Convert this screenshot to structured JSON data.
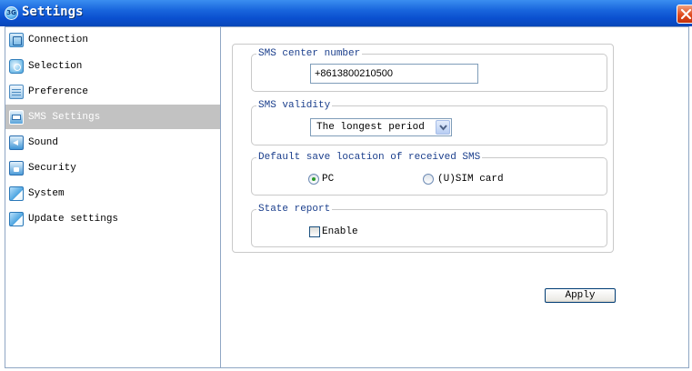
{
  "window": {
    "title": "Settings",
    "app_icon_text": "3G",
    "close_icon": "close-icon"
  },
  "sidebar": {
    "items": [
      {
        "label": "Connection",
        "icon": "connection-icon",
        "selected": false
      },
      {
        "label": "Selection",
        "icon": "selection-icon",
        "selected": false
      },
      {
        "label": "Preference",
        "icon": "preference-icon",
        "selected": false
      },
      {
        "label": "SMS Settings",
        "icon": "sms-icon",
        "selected": true
      },
      {
        "label": "Sound",
        "icon": "sound-icon",
        "selected": false
      },
      {
        "label": "Security",
        "icon": "security-icon",
        "selected": false
      },
      {
        "label": "System",
        "icon": "system-icon",
        "selected": false
      },
      {
        "label": "Update settings",
        "icon": "update-icon",
        "selected": false
      }
    ]
  },
  "sms": {
    "center_number": {
      "legend": "SMS center number",
      "value": "+8613800210500"
    },
    "validity": {
      "legend": "SMS validity",
      "selected": "The longest period"
    },
    "save_location": {
      "legend": "Default save location of received SMS",
      "options": [
        {
          "label": "PC",
          "checked": true
        },
        {
          "label": "(U)SIM card",
          "checked": false
        }
      ]
    },
    "state_report": {
      "legend": "State report",
      "enable_label": "Enable",
      "enabled": false
    },
    "apply_label": "Apply"
  },
  "colors": {
    "titlebar": "#0a4fcf",
    "selected_item": "#c2c2c2",
    "legend_text": "#1a3e8c",
    "close_button": "#e04a1e"
  }
}
